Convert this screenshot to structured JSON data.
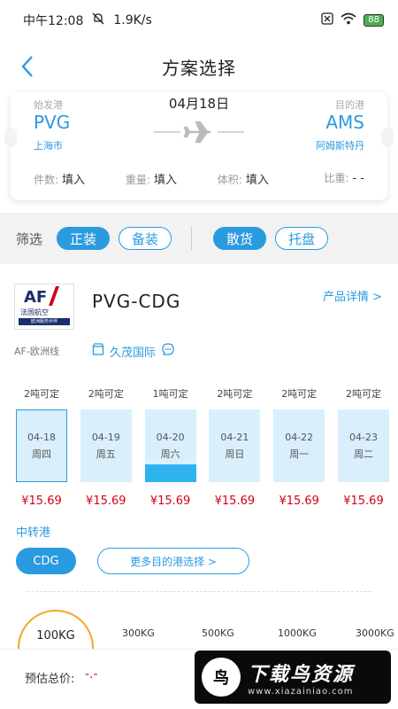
{
  "status_bar": {
    "time": "中午12:08",
    "speed": "1.9K/s",
    "battery": "88"
  },
  "nav": {
    "title": "方案选择"
  },
  "ticket": {
    "from_label": "始发港",
    "to_label": "目的港",
    "date": "04月18日",
    "from_code": "PVG",
    "to_code": "AMS",
    "from_city": "上海市",
    "to_city": "阿姆斯特丹",
    "fields": [
      {
        "label": "件数:",
        "value": "填入"
      },
      {
        "label": "重量:",
        "value": "填入"
      },
      {
        "label": "体积:",
        "value": "填入"
      },
      {
        "label": "比重:",
        "value": "- -"
      }
    ]
  },
  "filter": {
    "label": "筛选",
    "options": [
      {
        "label": "正装",
        "active": true
      },
      {
        "label": "备装",
        "active": false
      },
      {
        "label": "散货",
        "active": true
      },
      {
        "label": "托盘",
        "active": false
      }
    ]
  },
  "route": {
    "logo_text": "AF",
    "logo_cn": "法国航空",
    "logo_bar": "欧洲服务伙伴",
    "title": "PVG-CDG",
    "detail_link": "产品详情 >",
    "subtitle": "AF-欧洲线",
    "agent": "久茂国际"
  },
  "dates": [
    {
      "capacity": "2吨可定",
      "date": "04-18",
      "weekday": "周四",
      "price": "¥15.69",
      "fill": 0,
      "selected": true
    },
    {
      "capacity": "2吨可定",
      "date": "04-19",
      "weekday": "周五",
      "price": "¥15.69",
      "fill": 0,
      "selected": false
    },
    {
      "capacity": "1吨可定",
      "date": "04-20",
      "weekday": "周六",
      "price": "¥15.69",
      "fill": 0.25,
      "selected": false
    },
    {
      "capacity": "2吨可定",
      "date": "04-21",
      "weekday": "周日",
      "price": "¥15.69",
      "fill": 0,
      "selected": false
    },
    {
      "capacity": "2吨可定",
      "date": "04-22",
      "weekday": "周一",
      "price": "¥15.69",
      "fill": 0,
      "selected": false
    },
    {
      "capacity": "2吨可定",
      "date": "04-23",
      "weekday": "周二",
      "price": "¥15.69",
      "fill": 0,
      "selected": false
    }
  ],
  "transfer": {
    "label": "中转港",
    "selected": "CDG",
    "more": "更多目的港选择 >"
  },
  "weights": {
    "selected": "100KG",
    "options": [
      "300KG",
      "500KG",
      "1000KG",
      "3000KG"
    ]
  },
  "footer": {
    "total_label": "预估总价:",
    "total_value": "-.-"
  },
  "watermark": {
    "glyph": "鸟",
    "text": "下载鸟资源",
    "url": "www.xiazainiao.com"
  },
  "colors": {
    "accent": "#2a9be0",
    "price": "#d0021b",
    "orange": "#f5a623"
  }
}
